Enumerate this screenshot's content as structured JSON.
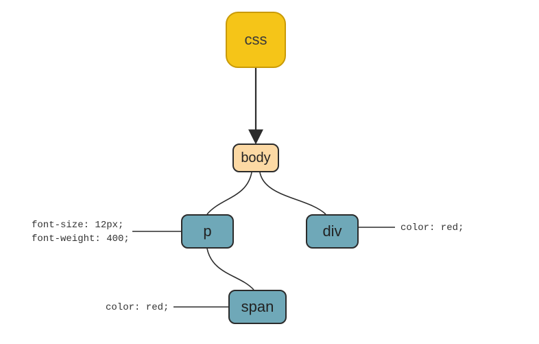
{
  "diagram": {
    "nodes": {
      "css": {
        "label": "css"
      },
      "body": {
        "label": "body"
      },
      "p": {
        "label": "p"
      },
      "div": {
        "label": "div"
      },
      "span": {
        "label": "span"
      }
    },
    "annotations": {
      "p_line1": "font-size: 12px;",
      "p_line2": "font-weight: 400;",
      "div": "color: red;",
      "span": "color: red;"
    },
    "edges": [
      {
        "from": "css",
        "to": "body",
        "arrow": true
      },
      {
        "from": "body",
        "to": "p",
        "arrow": false
      },
      {
        "from": "body",
        "to": "div",
        "arrow": false
      },
      {
        "from": "p",
        "to": "span",
        "arrow": false
      }
    ]
  }
}
